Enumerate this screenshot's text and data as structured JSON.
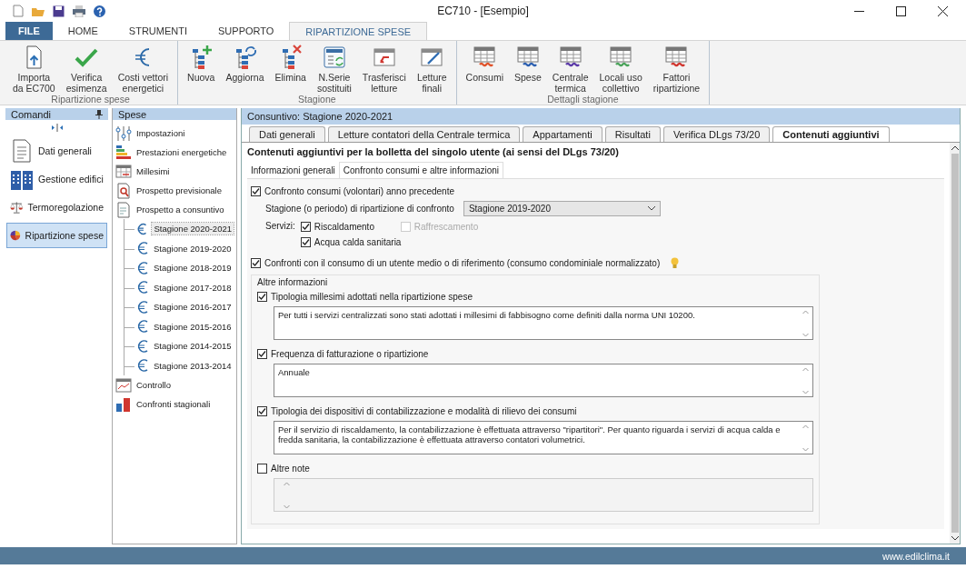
{
  "window": {
    "title": "EC710 - [Esempio]"
  },
  "ribbon_tabs": [
    {
      "label": "FILE",
      "kind": "file",
      "selected": false
    },
    {
      "label": "HOME",
      "kind": "tab",
      "selected": false
    },
    {
      "label": "STRUMENTI",
      "kind": "tab",
      "selected": false
    },
    {
      "label": "SUPPORTO",
      "kind": "tab",
      "selected": false
    },
    {
      "label": "RIPARTIZIONE SPESE",
      "kind": "tab",
      "selected": true
    }
  ],
  "ribbon_groups": [
    {
      "label": "Ripartizione spese",
      "buttons": [
        {
          "label": "Importa\nda EC700",
          "kind": "import"
        },
        {
          "label": "Verifica\nesimenza",
          "kind": "check"
        },
        {
          "label": "Costi vettori\nenergetici",
          "kind": "euro"
        }
      ]
    },
    {
      "label": "Stagione",
      "buttons": [
        {
          "label": "Nuova",
          "kind": "tree-add"
        },
        {
          "label": "Aggiorna",
          "kind": "tree-refresh"
        },
        {
          "label": "Elimina",
          "kind": "tree-delete"
        },
        {
          "label": "N.Serie\nsostituiti",
          "kind": "serial"
        },
        {
          "label": "Trasferisci\nletture",
          "kind": "transfer"
        },
        {
          "label": "Letture\nfinali",
          "kind": "final"
        }
      ]
    },
    {
      "label": "Dettagli stagione",
      "buttons": [
        {
          "label": "Consumi",
          "kind": "table",
          "color": "#e0532b"
        },
        {
          "label": "Spese",
          "kind": "table",
          "color": "#2c5fb0"
        },
        {
          "label": "Centrale\ntermica",
          "kind": "table",
          "color": "#5b3aa8"
        },
        {
          "label": "Locali uso\ncollettivo",
          "kind": "table",
          "color": "#4aa35a"
        },
        {
          "label": "Fattori\nripartizione",
          "kind": "table",
          "color": "#d0362f"
        }
      ]
    }
  ],
  "commands_panel": {
    "title": "Comandi",
    "items": [
      {
        "label": "Dati generali",
        "kind": "document",
        "selected": false
      },
      {
        "label": "Gestione edifici",
        "kind": "buildings",
        "selected": false
      },
      {
        "label": "Termoregolazione",
        "kind": "scale",
        "selected": false
      },
      {
        "label": "Ripartizione spese",
        "kind": "pie",
        "selected": true
      }
    ]
  },
  "expenses_panel": {
    "title": "Spese",
    "items": [
      {
        "label": "Impostazioni",
        "kind": "sliders",
        "selected": false
      },
      {
        "label": "Prestazioni energetiche",
        "kind": "energy",
        "selected": false
      },
      {
        "label": "Millesimi",
        "kind": "table",
        "selected": false
      },
      {
        "label": "Prospetto previsionale",
        "kind": "search-doc",
        "selected": false
      },
      {
        "label": "Prospetto a consuntivo",
        "kind": "doc",
        "selected": false,
        "children": [
          {
            "label": "Stagione 2020-2021",
            "selected": true
          },
          {
            "label": "Stagione 2019-2020",
            "selected": false
          },
          {
            "label": "Stagione 2018-2019",
            "selected": false
          },
          {
            "label": "Stagione 2017-2018",
            "selected": false
          },
          {
            "label": "Stagione 2016-2017",
            "selected": false
          },
          {
            "label": "Stagione 2015-2016",
            "selected": false
          },
          {
            "label": "Stagione 2014-2015",
            "selected": false
          },
          {
            "label": "Stagione 2013-2014",
            "selected": false
          }
        ]
      },
      {
        "label": "Controllo",
        "kind": "line-chart",
        "selected": false
      },
      {
        "label": "Confronti stagionali",
        "kind": "bar-chart",
        "selected": false
      }
    ]
  },
  "main": {
    "title": "Consuntivo: Stagione 2020-2021",
    "tabs": [
      {
        "label": "Dati generali",
        "selected": false
      },
      {
        "label": "Letture contatori della Centrale termica",
        "selected": false
      },
      {
        "label": "Appartamenti",
        "selected": false
      },
      {
        "label": "Risultati",
        "selected": false
      },
      {
        "label": "Verifica DLgs 73/20",
        "selected": false
      },
      {
        "label": "Contenuti aggiuntivi",
        "selected": true
      }
    ],
    "heading": "Contenuti aggiuntivi per la bolletta del singolo utente (ai sensi del DLgs 73/20)",
    "subtabs": [
      {
        "label": "Informazioni generali",
        "selected": false
      },
      {
        "label": "Confronto consumi e altre informazioni",
        "selected": true
      }
    ],
    "compare": {
      "label": "Confronto consumi (volontari) anno precedente",
      "checked": true,
      "season_label": "Stagione (o periodo) di ripartizione di confronto",
      "season_value": "Stagione 2019-2020",
      "services_label": "Servizi:",
      "services": [
        {
          "label": "Riscaldamento",
          "checked": true,
          "disabled": false
        },
        {
          "label": "Raffrescamento",
          "checked": false,
          "disabled": true
        },
        {
          "label": "Acqua calda sanitaria",
          "checked": true,
          "disabled": false
        }
      ]
    },
    "reference": {
      "label": "Confronti con il consumo di un utente medio o di riferimento (consumo condominiale normalizzato)",
      "checked": true
    },
    "other_info": {
      "title": "Altre informazioni",
      "sections": [
        {
          "label": "Tipologia millesimi adottati nella ripartizione spese",
          "checked": true,
          "value": "Per tutti i servizi centralizzati sono stati adottati i millesimi di fabbisogno come definiti dalla norma UNI 10200."
        },
        {
          "label": "Frequenza di fatturazione o ripartizione",
          "checked": true,
          "value": "Annuale"
        },
        {
          "label": "Tipologia dei dispositivi di contabilizzazione e modalità di rilievo dei consumi",
          "checked": true,
          "value": "Per il servizio di riscaldamento, la contabilizzazione è effettuata attraverso \"ripartitori\". Per quanto riguarda i servizi di acqua calda e fredda sanitaria, la contabilizzazione è effettuata attraverso contatori volumetrici."
        },
        {
          "label": "Altre note",
          "checked": false
        }
      ]
    }
  },
  "status_bar": {
    "text": "www.edilclima.it"
  }
}
